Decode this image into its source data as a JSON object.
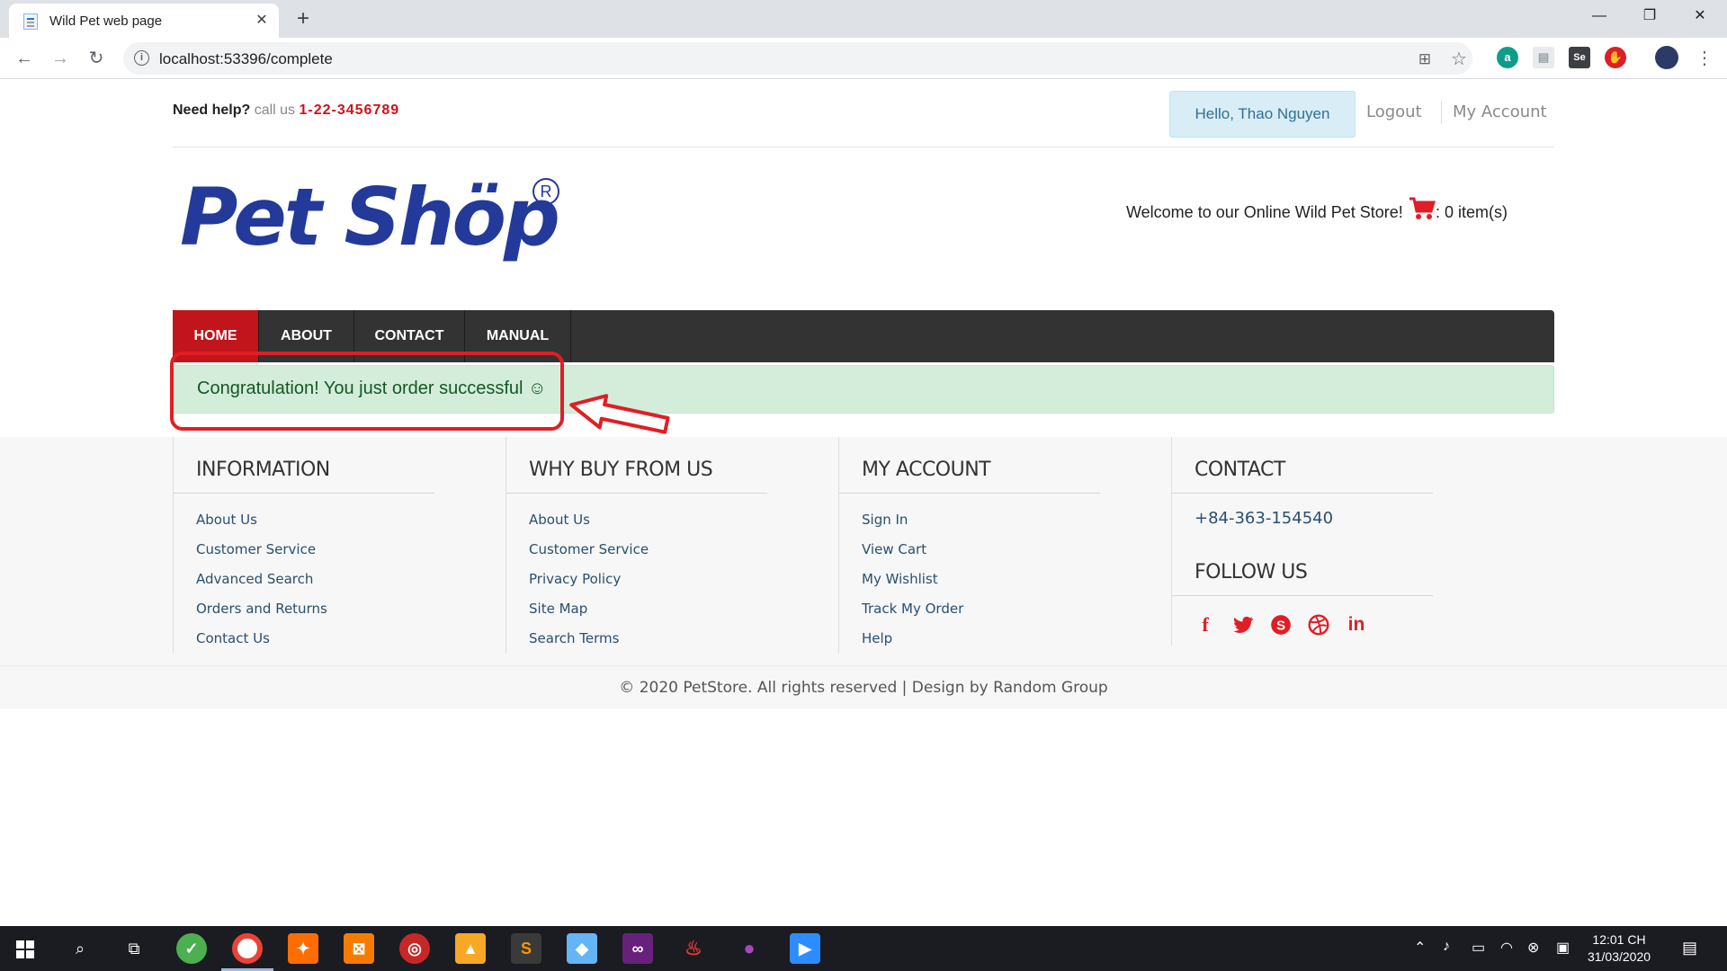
{
  "browser": {
    "tab_title": "Wild Pet web page",
    "url": "localhost:53396/complete"
  },
  "topbar": {
    "help_label": "Need help?",
    "call_label": "call us",
    "phone": "1-22-3456789",
    "hello": "Hello, Thao Nguyen",
    "logout": "Logout",
    "account": "My Account"
  },
  "logo": {
    "text": "Pet Shöp",
    "reg": "R"
  },
  "header": {
    "welcome": "Welcome to our Online Wild Pet Store!",
    "cart_count": ": 0 item(s)"
  },
  "nav": {
    "items": [
      {
        "label": "HOME"
      },
      {
        "label": "ABOUT"
      },
      {
        "label": "CONTACT"
      },
      {
        "label": "MANUAL"
      }
    ]
  },
  "alert": {
    "text": "Congratulation! You just order successful ☺"
  },
  "footer": {
    "columns": [
      {
        "title": "INFORMATION",
        "links": [
          "About Us",
          "Customer Service",
          "Advanced Search",
          "Orders and Returns",
          "Contact Us"
        ]
      },
      {
        "title": "WHY BUY FROM US",
        "links": [
          "About Us",
          "Customer Service",
          "Privacy Policy",
          "Site Map",
          "Search Terms"
        ]
      },
      {
        "title": "MY ACCOUNT",
        "links": [
          "Sign In",
          "View Cart",
          "My Wishlist",
          "Track My Order",
          "Help"
        ]
      }
    ],
    "contact": {
      "title": "CONTACT",
      "phone": "+84-363-154540",
      "follow": "FOLLOW US"
    },
    "copyright": "© 2020 PetStore. All rights reserved | Design by Random Group"
  },
  "taskbar": {
    "time": "12:01 CH",
    "date": "31/03/2020"
  },
  "colors": {
    "brand_red": "#c1151b",
    "logo_blue": "#233a9a",
    "alert_green": "#d4edda"
  }
}
